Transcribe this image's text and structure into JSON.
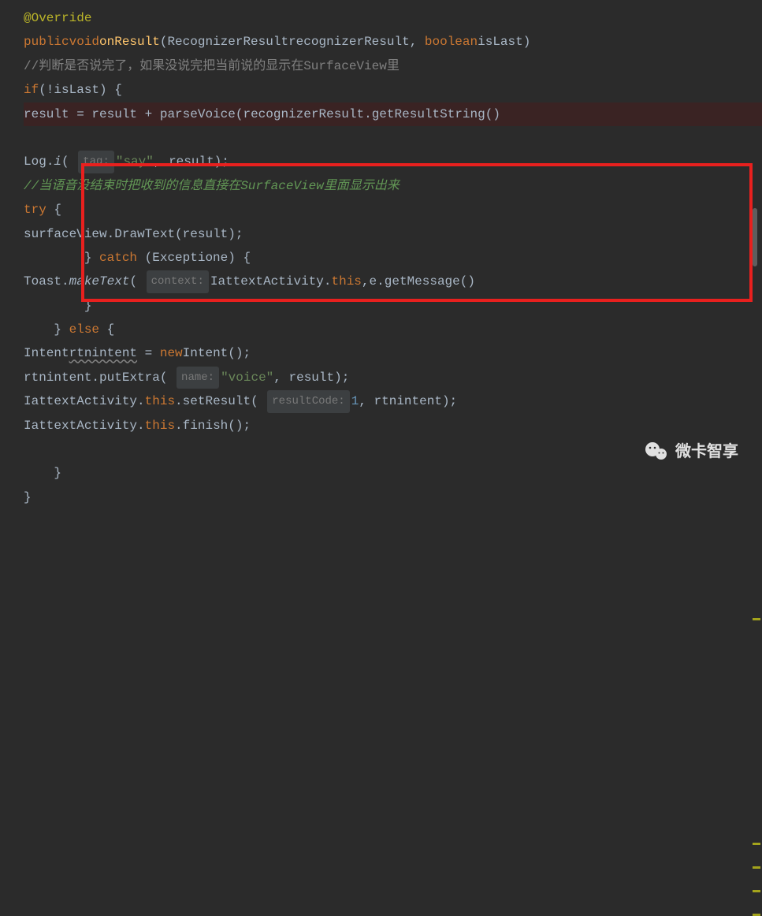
{
  "code": {
    "annotation": "@Override",
    "kw_public": "public",
    "kw_void": "void",
    "method_onResult": "onResult",
    "cls_RecognizerResult": "RecognizerResult",
    "param_recognizerResult": "recognizerResult",
    "kw_boolean": "boolean",
    "param_isLast": "isLast",
    "comment1": "//判断是否说完了，如果没说完把当前说的显示在SurfaceView里",
    "kw_if": "if",
    "neg_isLast": "(!isLast)",
    "var_result": "result",
    "eq": " = ",
    "plus": " + ",
    "method_parseVoice": "parseVoice",
    "method_getResultString": "getResultString",
    "cls_Log": "Log",
    "method_i": "i",
    "hint_tag": "tag:",
    "str_say": "\"say\"",
    "comment2": "//当语音没结束时把收到的信息直接在SurfaceView里面显示出来",
    "kw_try": "try",
    "var_surfaceView": "surfaceView",
    "method_DrawText": "DrawText",
    "kw_catch": "catch",
    "cls_Exception": "Exception",
    "var_e": "e",
    "cls_Toast": "Toast",
    "method_makeText": "makeText",
    "hint_context": "context:",
    "cls_IattextActivity": "IattextActivity",
    "kw_this": "this",
    "method_getMessage": "getMessage",
    "kw_else": "else",
    "cls_Intent": "Intent",
    "var_rtnintent": "rtnintent",
    "kw_new": "new",
    "method_putExtra": "putExtra",
    "hint_name": "name:",
    "str_voice": "\"voice\"",
    "method_setResult": "setResult",
    "hint_resultCode": "resultCode:",
    "num_1": "1",
    "method_finish": "finish"
  },
  "watermark": "微卡智享"
}
